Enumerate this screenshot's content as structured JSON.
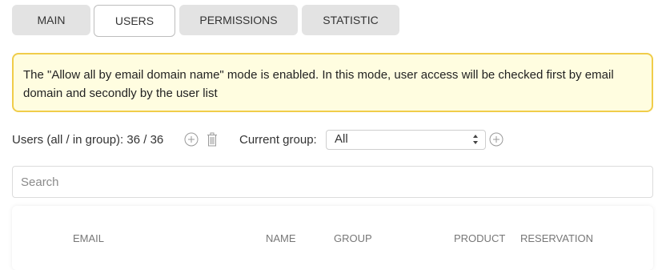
{
  "tabs": [
    {
      "label": "MAIN"
    },
    {
      "label": "USERS",
      "active": true
    },
    {
      "label": "PERMISSIONS"
    },
    {
      "label": "STATISTIC"
    }
  ],
  "alert": {
    "text": "The \"Allow all by email domain name\" mode is enabled. In this mode, user access will be checked first by email domain and secondly by the user list"
  },
  "users": {
    "count_label": "Users (all / in group): 36 / 36",
    "add_icon": "plus-circle-icon",
    "delete_icon": "trash-icon"
  },
  "group": {
    "label": "Current group:",
    "selected": "All",
    "add_icon": "plus-circle-icon"
  },
  "search": {
    "placeholder": "Search",
    "value": ""
  },
  "table": {
    "headers": [
      "EMAIL",
      "NAME",
      "GROUP",
      "PRODUCT",
      "RESERVATION"
    ]
  },
  "colors": {
    "alert_bg": "#fffde0",
    "alert_border": "#f0cd4a",
    "tab_bg": "#e3e3e3"
  }
}
